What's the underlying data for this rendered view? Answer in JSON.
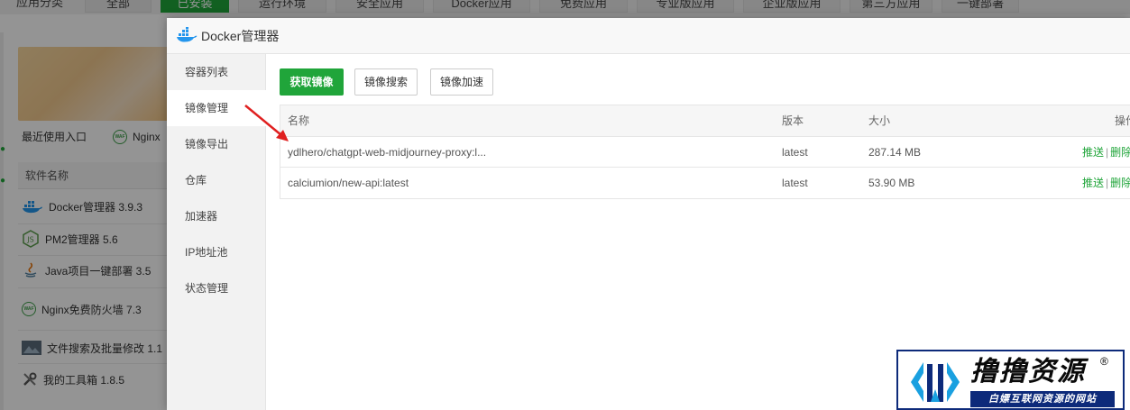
{
  "background": {
    "category_label": "应用分类",
    "category_tabs": [
      "全部",
      "已安装",
      "运行环境",
      "安全应用",
      "Docker应用",
      "免费应用",
      "专业版应用",
      "企业版应用",
      "第三方应用",
      "一键部署"
    ],
    "active_tab_index": 1,
    "recent_label": "最近使用入口",
    "recent_waf_label": "Nginx",
    "software_header": "软件名称",
    "software_items": [
      {
        "label": "Docker管理器 3.9.3",
        "icon": "docker-icon"
      },
      {
        "label": "PM2管理器 5.6",
        "icon": "nodejs-icon"
      },
      {
        "label": "Java项目一键部署 3.5",
        "icon": "java-icon"
      },
      {
        "label": "Nginx免费防火墙 7.3",
        "icon": "waf-icon"
      },
      {
        "label": "文件搜索及批量修改 1.1",
        "icon": "image-icon"
      },
      {
        "label": "我的工具箱 1.8.5",
        "icon": "tools-icon"
      }
    ]
  },
  "modal": {
    "title": "Docker管理器",
    "nav": [
      "容器列表",
      "镜像管理",
      "镜像导出",
      "仓库",
      "加速器",
      "IP地址池",
      "状态管理"
    ],
    "active_nav_index": 1,
    "buttons": {
      "pull": "获取镜像",
      "search": "镜像搜索",
      "accelerate": "镜像加速"
    },
    "table": {
      "headers": {
        "name": "名称",
        "version": "版本",
        "size": "大小",
        "actions": "操作"
      },
      "rows": [
        {
          "name": "ydlhero/chatgpt-web-midjourney-proxy:l...",
          "version": "latest",
          "size": "287.14 MB",
          "push": "推送",
          "sep": "|",
          "delete": "删除"
        },
        {
          "name": "calciumion/new-api:latest",
          "version": "latest",
          "size": "53.90 MB",
          "push": "推送",
          "sep": "|",
          "delete": "删除"
        }
      ]
    }
  },
  "watermark": {
    "title": "撸撸资源",
    "registered": "®",
    "subtitle": "白嫖互联网资源的网站"
  },
  "colors": {
    "accent": "#20a53a",
    "arrow": "#e02020",
    "watermark_blue": "#0d2a7a"
  }
}
